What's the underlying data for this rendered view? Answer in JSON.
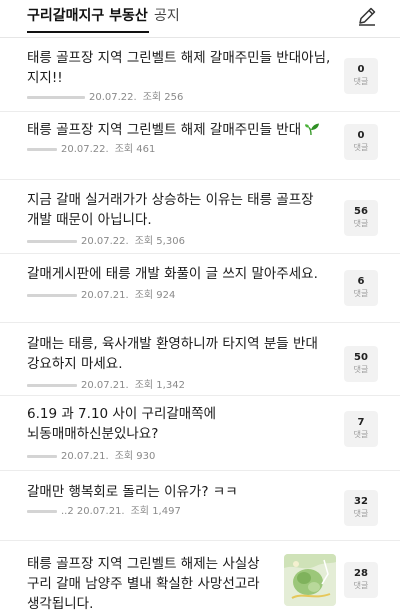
{
  "header": {
    "active_tab": "구리갈매지구 부동산",
    "notice_tab": "공지",
    "write_icon": "pencil-icon"
  },
  "reply_label": "댓글",
  "posts": [
    {
      "title": "태릉 골프장 지역 그린벨트 해제 갈매주민들 반대아님,지지!!",
      "date": "20.07.22.",
      "views": "조회 256",
      "replies": "0"
    },
    {
      "title": "태릉 골프장 지역 그린벨트 해제 갈매주민들 반대",
      "title_icon": "sprout-icon",
      "date": "20.07.22.",
      "views": "조회 461",
      "replies": "0"
    },
    {
      "title": "지금 갈매 실거래가가 상승하는 이유는 태릉 골프장 개발 때문이 아닙니다.",
      "date": "20.07.22.",
      "views": "조회 5,306",
      "replies": "56"
    },
    {
      "title": "갈매게시판에 태릉 개발 화풀이 글 쓰지 말아주세요.",
      "date": "20.07.21.",
      "views": "조회 924",
      "replies": "6"
    },
    {
      "title": "갈매는 태릉, 육사개발 환영하니까 타지역 분들 반대 강요하지 마세요.",
      "date": "20.07.21.",
      "views": "조회 1,342",
      "replies": "50"
    },
    {
      "title": "6.19 과 7.10 사이 구리갈매쪽에 뇌동매매하신분있나요?",
      "date": "20.07.21.",
      "views": "조회 930",
      "replies": "7"
    },
    {
      "title": "갈매만 행복회로 돌리는 이유가? ㅋㅋ",
      "date": "..2 20.07.21.",
      "views": "조회 1,497",
      "replies": "32"
    },
    {
      "title": "태릉 골프장 지역 그린벨트 해제는 사실상 구리 갈매 남양주 별내 확실한 사망선고라 생각됩니다.",
      "thumbnail": "map-thumbnail",
      "replies": "28"
    }
  ]
}
